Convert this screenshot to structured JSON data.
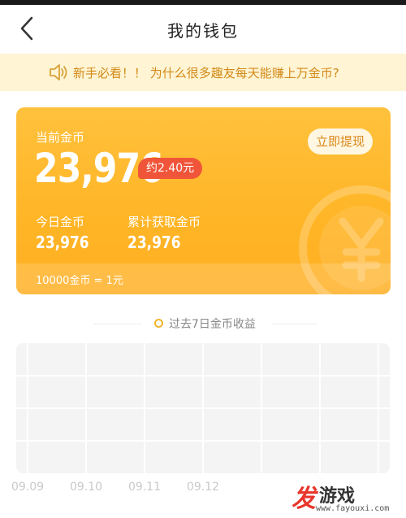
{
  "header": {
    "title": "我的钱包",
    "back_icon": "chevron-left-icon"
  },
  "notice": {
    "icon": "speaker-icon",
    "text": "新手必看！！ 为什么很多趣友每天能赚上万金币?"
  },
  "wallet": {
    "current_label": "当前金币",
    "current_value": "23,976",
    "approx": "约2.40元",
    "withdraw_label": "立即提现",
    "today_label": "今日金币",
    "today_value": "23,976",
    "total_label": "累计获取金币",
    "total_value": "23,976",
    "rate_text": "10000金币 = 1元",
    "colors": {
      "card": "#ffb526",
      "badge": "#f0553a",
      "withdraw_text": "#d9881a"
    }
  },
  "earnings": {
    "section_title": "过去7日金币收益",
    "dot_color": "#f2b52b",
    "x_labels": [
      "09.09",
      "09.10",
      "09.11",
      "09.12"
    ]
  },
  "watermark": {
    "logo_char": "发",
    "name": "游戏",
    "url": "www.fayouxi.com"
  }
}
